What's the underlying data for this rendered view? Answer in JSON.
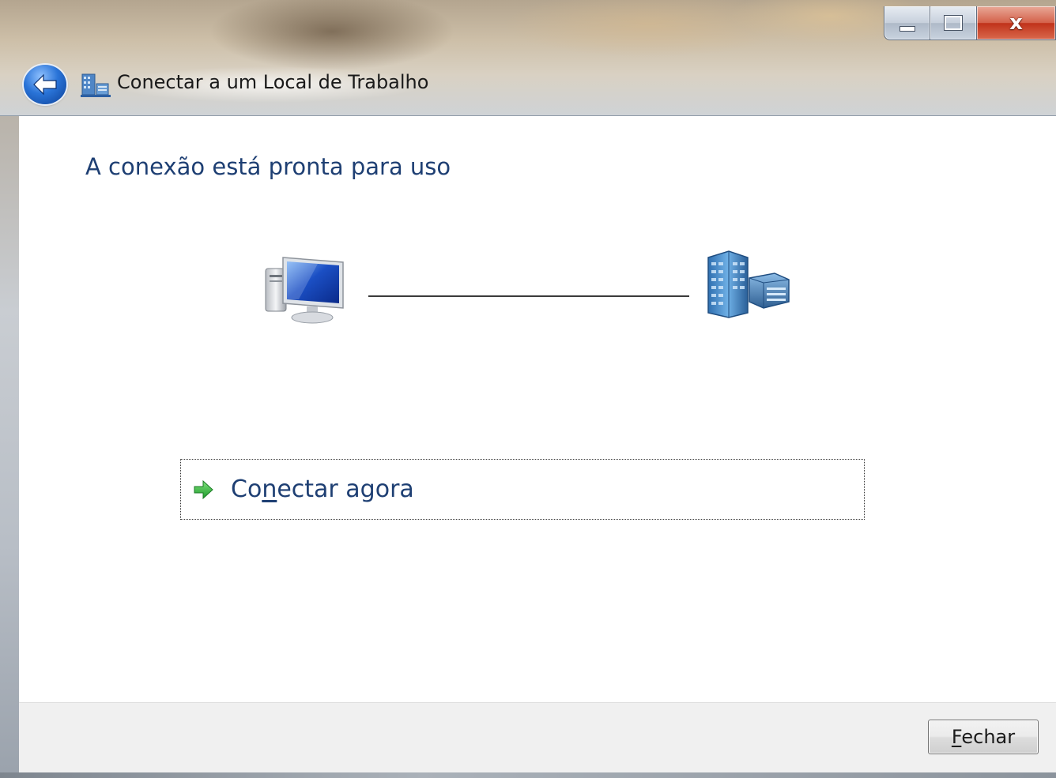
{
  "window": {
    "title": "Conectar a um Local de Trabalho",
    "caption_buttons": {
      "minimize_icon": "minimize-icon",
      "maximize_icon": "maximize-icon",
      "close_icon": "close-icon",
      "close_glyph": "x"
    },
    "back_icon": "back-arrow-icon",
    "app_icon": "workplace-network-icon"
  },
  "main": {
    "heading": "A conexão está pronta para uso",
    "diagram": {
      "left_icon": "computer-icon",
      "right_icon": "server-building-icon"
    },
    "connect_link": {
      "label_before": "Co",
      "label_accel": "n",
      "label_after": "ectar agora",
      "icon": "green-arrow-icon"
    }
  },
  "footer": {
    "close_button": {
      "accel": "F",
      "rest": "echar"
    }
  },
  "colors": {
    "heading": "#1e3f73",
    "footer_bg": "#f0f0f0",
    "close_caption": "#c0321a"
  }
}
